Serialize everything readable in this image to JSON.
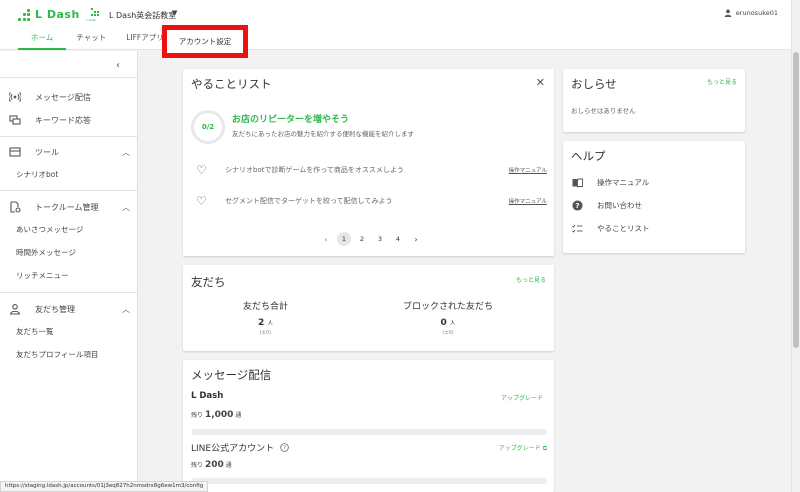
{
  "header": {
    "logo_text": "L Dash",
    "account_logo_label": "L Dash",
    "account_name": "L Dash英会話教室",
    "user_name": "erunosuke01",
    "tabs": [
      "ホーム",
      "チャット",
      "LIFFアプリ",
      "アカウント設定"
    ]
  },
  "sidebar": {
    "message_delivery": "メッセージ配信",
    "keyword_reply": "キーワード応答",
    "tools": "ツール",
    "scenario_bot": "シナリオbot",
    "talkroom_mgmt": "トークルーム管理",
    "greeting_msg": "あいさつメッセージ",
    "off_hours_msg": "時間外メッセージ",
    "rich_menu": "リッチメニュー",
    "friends_mgmt": "友だち管理",
    "friends_list": "友だち一覧",
    "friends_profile": "友だちプロフィール項目"
  },
  "todo": {
    "title": "やることリスト",
    "progress": "0/2",
    "progress_done": 0,
    "progress_total": 2,
    "headline": "お店のリピーターを増やそう",
    "description": "友だちにあったお店の魅力を紹介する便利な機能を紹介します",
    "items": [
      {
        "text": "シナリオbotで診断ゲームを作って商品をオススメしよう",
        "link": "操作マニュアル"
      },
      {
        "text": "セグメント配信でターゲットを絞って配信してみよう",
        "link": "操作マニュアル"
      }
    ],
    "pages": [
      "1",
      "2",
      "3",
      "4"
    ]
  },
  "friends": {
    "title": "友だち",
    "more": "もっと見る",
    "total_label": "友だち合計",
    "total_value": "2",
    "total_unit": "人",
    "total_diff": "(±0)",
    "blocked_label": "ブロックされた友だち",
    "blocked_value": "0",
    "blocked_unit": "人",
    "blocked_diff": "(±0)"
  },
  "messages": {
    "title": "メッセージ配信",
    "ldash_name": "L Dash",
    "ldash_remaining_prefix": "残り",
    "ldash_remaining_value": "1,000",
    "ldash_remaining_unit": "通",
    "upgrade": "アップグレード",
    "line_name": "LINE公式アカウント",
    "line_upgrade": "アップグレード",
    "line_remaining_prefix": "残り",
    "line_remaining_value": "200",
    "line_remaining_unit": "通"
  },
  "news": {
    "title": "おしらせ",
    "more": "もっと見る",
    "empty": "おしらせはありません"
  },
  "help": {
    "title": "ヘルプ",
    "items": [
      "操作マニュアル",
      "お問い合わせ",
      "やることリスト"
    ]
  },
  "status_url": "https://staging.ldash.jp/accounts/01j3eq827h2nmsdrx8g6ew1m3/config",
  "colors": {
    "brand": "#2eb84b",
    "highlight": "#ee1111"
  }
}
